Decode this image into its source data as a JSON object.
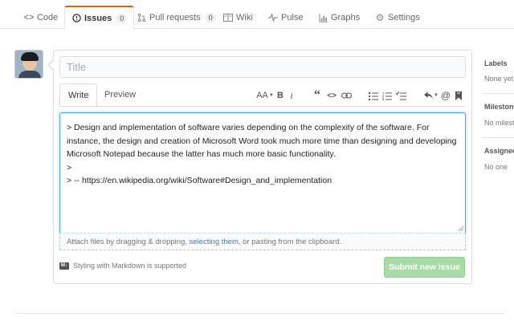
{
  "nav": {
    "tabs": [
      {
        "label": "Code",
        "icon": "code-icon"
      },
      {
        "label": "Issues",
        "icon": "issue-icon",
        "count": "0",
        "selected": true
      },
      {
        "label": "Pull requests",
        "icon": "pull-request-icon",
        "count": "0"
      },
      {
        "label": "Wiki",
        "icon": "book-icon"
      },
      {
        "label": "Pulse",
        "icon": "pulse-icon"
      },
      {
        "label": "Graphs",
        "icon": "graph-icon"
      },
      {
        "label": "Settings",
        "icon": "gear-icon"
      }
    ],
    "accent_color": "#e36209"
  },
  "issue_form": {
    "title_placeholder": "Title",
    "title_value": "",
    "write_tab": "Write",
    "preview_tab": "Preview",
    "body": "> Design and implementation of software varies depending on the complexity of the software. For instance, the design and creation of Microsoft Word took much more time than designing and developing Microsoft Notepad because the latter has much more basic functionality.\n>\n> -- https://en.wikipedia.org/wiki/Software#Design_and_implementation",
    "attach_prefix": "Attach files by dragging & dropping, ",
    "attach_link": "selecting them",
    "attach_suffix": ", or pasting from the clipboard.",
    "markdown_note": "Styling with Markdown is supported",
    "submit_label": "Submit new issue",
    "submit_color": "#a8dba8",
    "focus_color": "#51a7e8"
  },
  "toolbar": {
    "header_label": "AA",
    "bold_label": "B",
    "italic_label": "i"
  },
  "sidebar": {
    "labels_heading": "Labels",
    "labels_value": "None yet",
    "milestone_heading": "Milestone",
    "milestone_value": "No milestone",
    "assignee_heading": "Assignees",
    "assignee_value": "No one"
  }
}
